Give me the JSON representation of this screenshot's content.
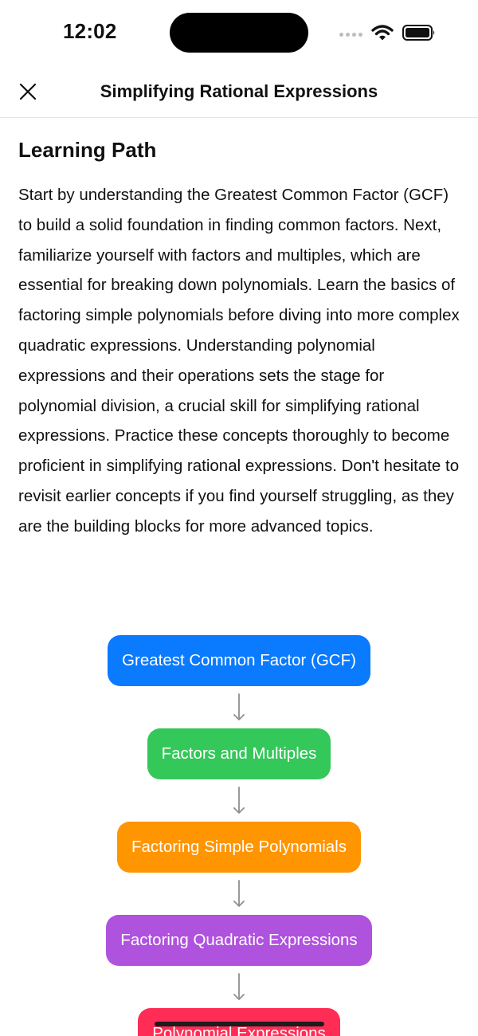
{
  "status_bar": {
    "time": "12:02"
  },
  "nav": {
    "title": "Simplifying Rational Expressions",
    "close_icon": "close-icon"
  },
  "content": {
    "section_title": "Learning Path",
    "description": "Start by understanding the Greatest Common Factor (GCF) to build a solid foundation in finding common factors. Next, familiarize yourself with factors and multiples, which are essential for breaking down polynomials. Learn the basics of factoring simple polynomials before diving into more complex quadratic expressions. Understanding polynomial expressions and their operations sets the stage for polynomial division, a crucial skill for simplifying rational expressions. Practice these concepts thoroughly to become proficient in simplifying rational expressions. Don't hesitate to revisit earlier concepts if you find yourself struggling, as they are the building blocks for more advanced topics."
  },
  "path": {
    "arrow_icon": "arrow-down-icon",
    "steps": [
      {
        "label": "Greatest Common Factor (GCF)",
        "color": "#0a7aff"
      },
      {
        "label": "Factors and Multiples",
        "color": "#34c759"
      },
      {
        "label": "Factoring Simple Polynomials",
        "color": "#ff9500"
      },
      {
        "label": "Factoring Quadratic Expressions",
        "color": "#af52de"
      },
      {
        "label": "Polynomial Expressions",
        "color": "#ff2d55"
      }
    ]
  }
}
